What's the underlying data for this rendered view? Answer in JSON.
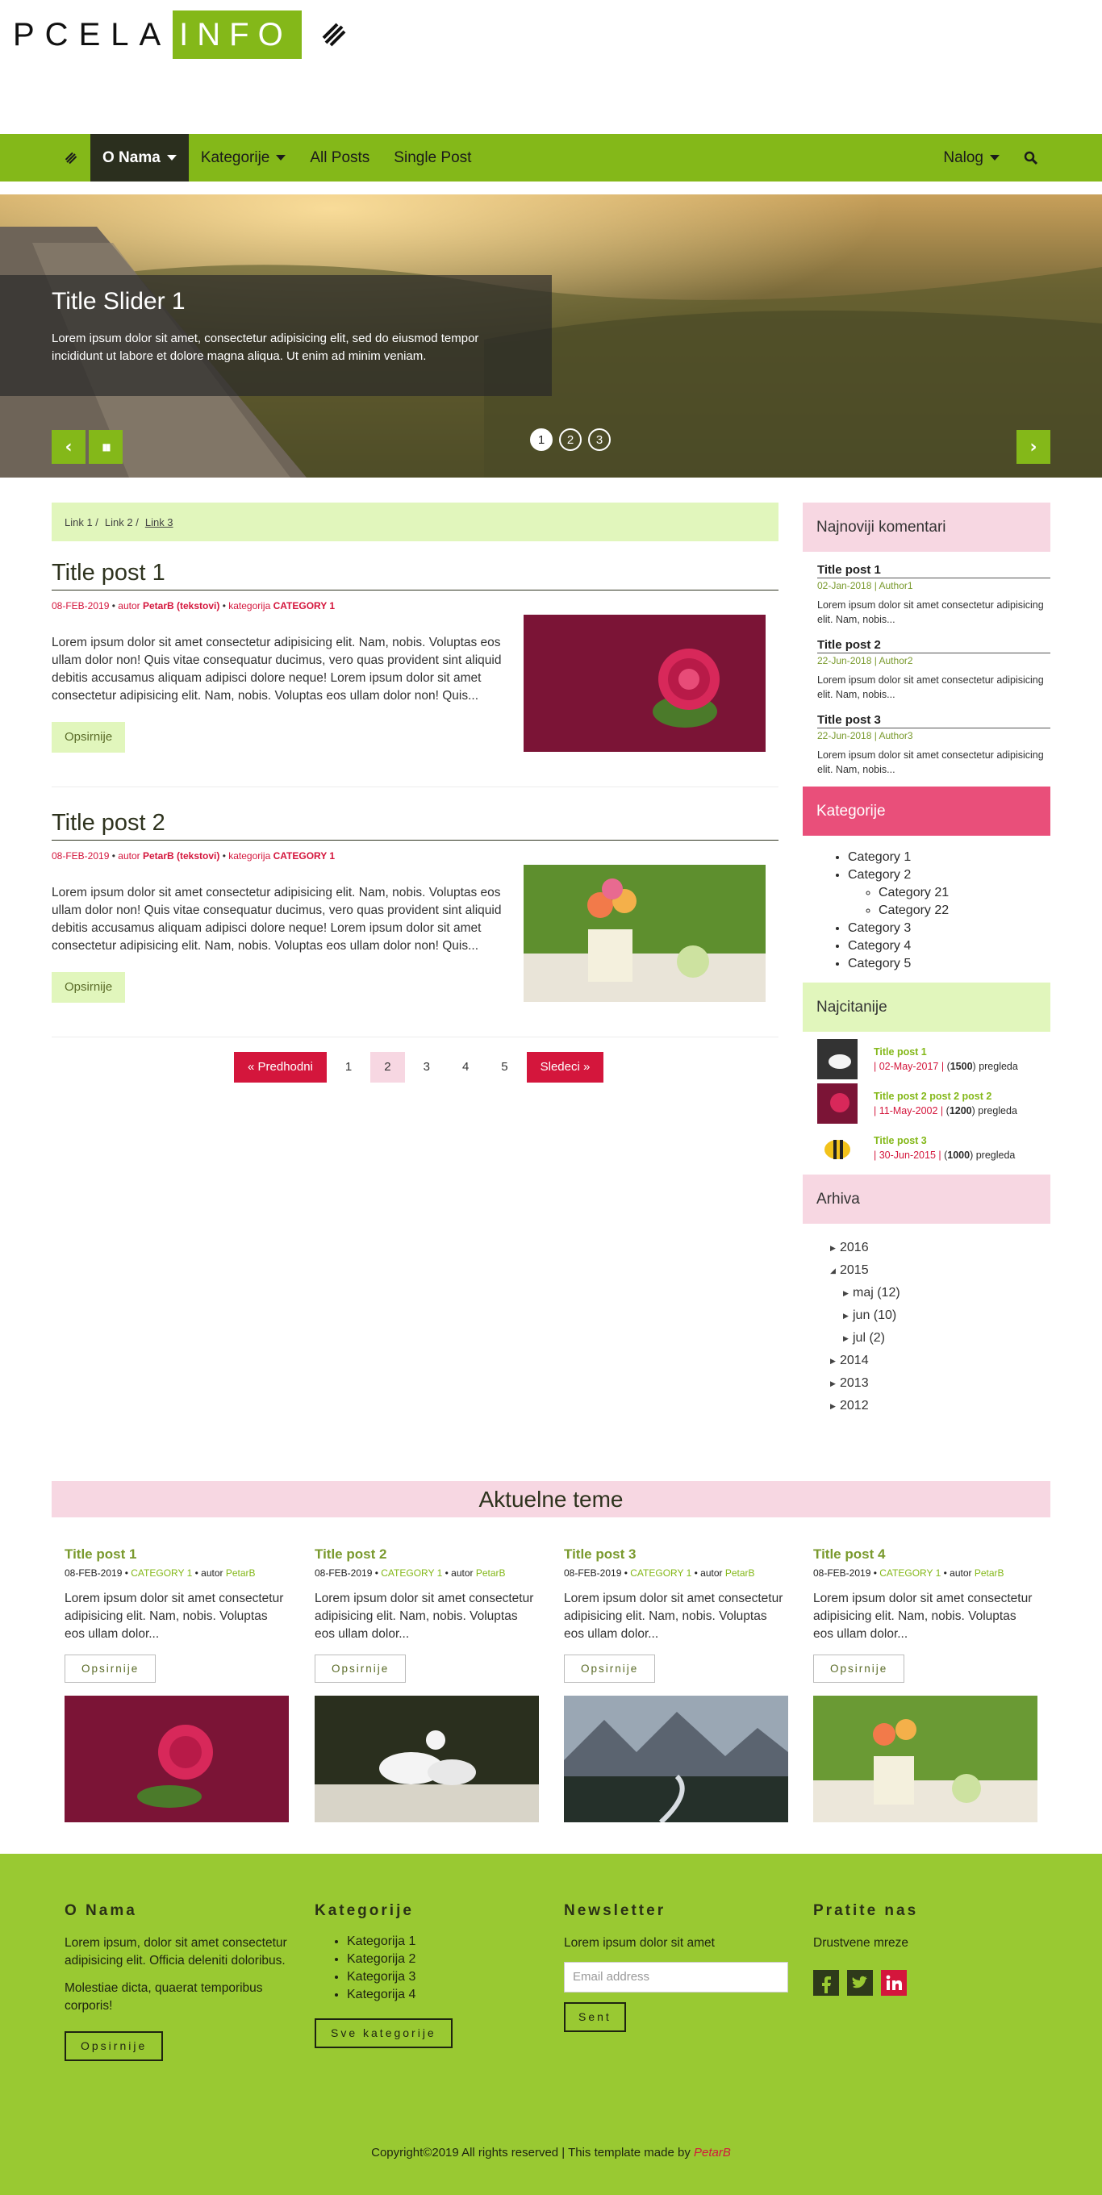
{
  "brand": {
    "left": "PCELA",
    "right": "INFO"
  },
  "nav": {
    "items": [
      "O Nama",
      "Kategorije",
      "All Posts",
      "Single Post"
    ],
    "account": "Nalog"
  },
  "slider": {
    "title": "Title Slider 1",
    "text": "Lorem ipsum dolor sit amet, consectetur adipisicing elit, sed do eiusmod tempor incididunt ut labore et dolore magna aliqua. Ut enim ad minim veniam.",
    "prev": "‹",
    "pause": "▮▮",
    "next": "›",
    "dots": [
      "1",
      "2",
      "3"
    ]
  },
  "breadcrumb": [
    "Link 1 /",
    "Link 2 /",
    "Link 3"
  ],
  "posts": [
    {
      "title": "Title post 1",
      "date": "08-FEB-2019",
      "autor_label": "autor",
      "author": "PetarB (tekstovi)",
      "kat_label": "kategorija",
      "category": "CATEGORY 1",
      "text": "Lorem ipsum dolor sit amet consectetur adipisicing elit. Nam, nobis. Voluptas eos ullam dolor non! Quis vitae consequatur ducimus, vero quas provident sint aliquid debitis accusamus aliquam adipisci dolore neque! Lorem ipsum dolor sit amet consectetur adipisicing elit. Nam, nobis. Voluptas eos ullam dolor non! Quis...",
      "button": "Opsirnije"
    },
    {
      "title": "Title post 2",
      "date": "08-FEB-2019",
      "autor_label": "autor",
      "author": "PetarB (tekstovi)",
      "kat_label": "kategorija",
      "category": "CATEGORY 1",
      "text": "Lorem ipsum dolor sit amet consectetur adipisicing elit. Nam, nobis. Voluptas eos ullam dolor non! Quis vitae consequatur ducimus, vero quas provident sint aliquid debitis accusamus aliquam adipisci dolore neque! Lorem ipsum dolor sit amet consectetur adipisicing elit. Nam, nobis. Voluptas eos ullam dolor non! Quis...",
      "button": "Opsirnije"
    }
  ],
  "pager": {
    "prev": "« Predhodni",
    "pages": [
      "1",
      "2",
      "3",
      "4",
      "5"
    ],
    "current": "2",
    "next": "Sledeci »"
  },
  "sidebar": {
    "comments_title": "Najnoviji komentari",
    "comments": [
      {
        "title": "Title post 1",
        "meta": "02-Jan-2018 | Author1",
        "text": "Lorem ipsum dolor sit amet consectetur adipisicing elit. Nam, nobis..."
      },
      {
        "title": "Title post 2",
        "meta": "22-Jun-2018 | Author2",
        "text": "Lorem ipsum dolor sit amet consectetur adipisicing elit. Nam, nobis..."
      },
      {
        "title": "Title post 3",
        "meta": "22-Jun-2018 | Author3",
        "text": "Lorem ipsum dolor sit amet consectetur adipisicing elit. Nam, nobis..."
      }
    ],
    "categories_title": "Kategorije",
    "categories": [
      "Category 1",
      "Category 2",
      "Category 21",
      "Category 22",
      "Category 3",
      "Category 4",
      "Category 5"
    ],
    "popular_title": "Najcitanije",
    "popular": [
      {
        "title": "Title post 1",
        "date": "| 02-May-2017 |",
        "views": "1500",
        "suffix": "pregleda"
      },
      {
        "title": "Title post 2 post 2 post 2",
        "date": "| 11-May-2002 |",
        "views": "1200",
        "suffix": "pregleda"
      },
      {
        "title": "Title post 3",
        "date": "| 30-Jun-2015 |",
        "views": "1000",
        "suffix": "pregleda"
      }
    ],
    "archive_title": "Arhiva",
    "archive": [
      "2016",
      "2015",
      "maj (12)",
      "jun (10)",
      "jul (2)",
      "2014",
      "2013",
      "2012"
    ]
  },
  "aktuelne": {
    "title": "Aktuelne teme",
    "cards": [
      {
        "title": "Title post 1",
        "date": "08-FEB-2019 •",
        "category": "CATEGORY 1",
        "autor": "• autor",
        "author": "PetarB",
        "text": "Lorem ipsum dolor sit amet consectetur adipisicing elit. Nam, nobis. Voluptas eos ullam dolor...",
        "button": "Opsirnije"
      },
      {
        "title": "Title post 2",
        "date": "08-FEB-2019 •",
        "category": "CATEGORY 1",
        "autor": "• autor",
        "author": "PetarB",
        "text": "Lorem ipsum dolor sit amet consectetur adipisicing elit. Nam, nobis. Voluptas eos ullam dolor...",
        "button": "Opsirnije"
      },
      {
        "title": "Title post 3",
        "date": "08-FEB-2019 •",
        "category": "CATEGORY 1",
        "autor": "• autor",
        "author": "PetarB",
        "text": "Lorem ipsum dolor sit amet consectetur adipisicing elit. Nam, nobis. Voluptas eos ullam dolor...",
        "button": "Opsirnije"
      },
      {
        "title": "Title post 4",
        "date": "08-FEB-2019 •",
        "category": "CATEGORY 1",
        "autor": "• autor",
        "author": "PetarB",
        "text": "Lorem ipsum dolor sit amet consectetur adipisicing elit. Nam, nobis. Voluptas eos ullam dolor...",
        "button": "Opsirnije"
      }
    ]
  },
  "footer": {
    "about_title": "O Nama",
    "about_p1": "Lorem ipsum, dolor sit amet consectetur adipisicing elit. Officia deleniti doloribus.",
    "about_p2": "Molestiae dicta, quaerat temporibus corporis!",
    "about_button": "Opsirnije",
    "cat_title": "Kategorije",
    "cats": [
      "Kategorija 1",
      "Kategorija 2",
      "Kategorija 3",
      "Kategorija 4"
    ],
    "cat_button": "Sve kategorije",
    "news_title": "Newsletter",
    "news_text": "Lorem ipsum dolor sit amet",
    "email_placeholder": "Email address",
    "news_button": "Sent",
    "follow_title": "Pratite nas",
    "follow_text": "Drustvene mreze",
    "copyright": "Copyright©2019 All rights reserved | This template made by",
    "maker": "PetarB"
  },
  "colors": {
    "green": "#84b819",
    "footer_green": "#99c932",
    "pink": "#f7d7e2",
    "hot_pink": "#e94f7a",
    "light_green": "#e1f6bc",
    "red": "#d4163c"
  }
}
